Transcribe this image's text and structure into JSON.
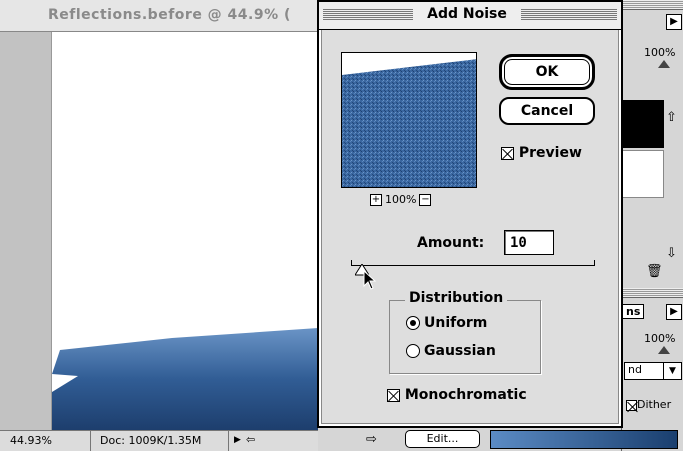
{
  "document": {
    "title": "Reflections.before @ 44.9% (",
    "status": {
      "zoom": "44.93%",
      "doc_size": "Doc: 1009K/1.35M"
    }
  },
  "dialog": {
    "title": "Add Noise",
    "ok_label": "OK",
    "cancel_label": "Cancel",
    "preview_label": "Preview",
    "preview_checked": true,
    "zoom_level": "100%",
    "zoom_in_glyph": "+",
    "zoom_out_glyph": "−",
    "amount_label": "Amount:",
    "amount_value": "10",
    "slider_value": 10,
    "distribution": {
      "legend": "Distribution",
      "options": [
        "Uniform",
        "Gaussian"
      ],
      "selected": "Uniform"
    },
    "monochromatic_label": "Monochromatic",
    "monochromatic_checked": true
  },
  "palettes": {
    "top_zoom": "100%",
    "mid_tab": "ns",
    "mid_zoom": "100%",
    "mode_select": "nd",
    "dither_label": "Dither",
    "dither_checked": true
  },
  "bottom_bar": {
    "edit_label": "Edit..."
  },
  "colors": {
    "water": "#2f5a92",
    "dialog_bg": "#dedede"
  }
}
